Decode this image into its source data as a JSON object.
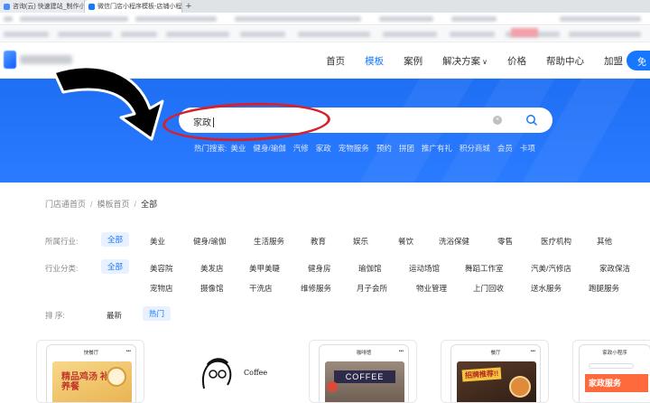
{
  "browser": {
    "tabs": [
      {
        "label": "咨询(云) 快速建站_制作小程序",
        "close": "×"
      },
      {
        "label": "微信门店小程序模板-店铺小程序",
        "close": "×"
      }
    ],
    "new_tab": "+"
  },
  "nav": {
    "links": [
      "首页",
      "模板",
      "案例",
      "解决方案",
      "价格",
      "帮助中心",
      "加盟"
    ],
    "active_index": 1,
    "dropdown_index": 3,
    "caret": "∨",
    "free_button": "免"
  },
  "hero": {
    "search_value": "家政",
    "clear_icon": "×",
    "hot_label": "热门搜索:",
    "hot_terms": [
      "美业",
      "健身/瑜伽",
      "汽修",
      "家政",
      "宠物服务",
      "预约",
      "拼团",
      "推广有礼",
      "积分商城",
      "会员",
      "卡项"
    ]
  },
  "breadcrumb": {
    "items": [
      "门店通首页",
      "模板首页"
    ],
    "current": "全部",
    "separator": "/"
  },
  "filters": {
    "industry": {
      "label": "所属行业:",
      "options": [
        "全部",
        "美业",
        "健身/瑜伽",
        "生活服务",
        "教育",
        "娱乐",
        "餐饮",
        "洗浴保健",
        "零售",
        "医疗机构",
        "其他"
      ]
    },
    "category": {
      "label": "行业分类:",
      "row1": [
        "全部",
        "美容院",
        "美发店",
        "美甲美睫",
        "健身房",
        "瑜伽馆",
        "运动场馆",
        "舞蹈工作室",
        "汽美/汽修店",
        "家政保洁"
      ],
      "row2": [
        "宠物店",
        "摄像馆",
        "干洗店",
        "维修服务",
        "月子会所",
        "物业管理",
        "上门回收",
        "送水服务",
        "跑腿服务"
      ]
    },
    "sort": {
      "label": "排 序:",
      "options": [
        "最新",
        "热门"
      ],
      "active": "热门"
    }
  },
  "cards": [
    {
      "title": "快餐厅",
      "image_text": "精品鸡汤 补养餐"
    },
    {
      "title": "",
      "image_text": "Coffee"
    },
    {
      "title": "咖啡馆",
      "image_text": "COFFEE"
    },
    {
      "title": "餐厅",
      "image_text": "招牌推荐!!"
    },
    {
      "title": "家政小程序",
      "image_text": "家政服务"
    }
  ],
  "colors": {
    "brand": "#1677ff",
    "hero": "#2a7bff",
    "annotation": "#d6202c"
  }
}
